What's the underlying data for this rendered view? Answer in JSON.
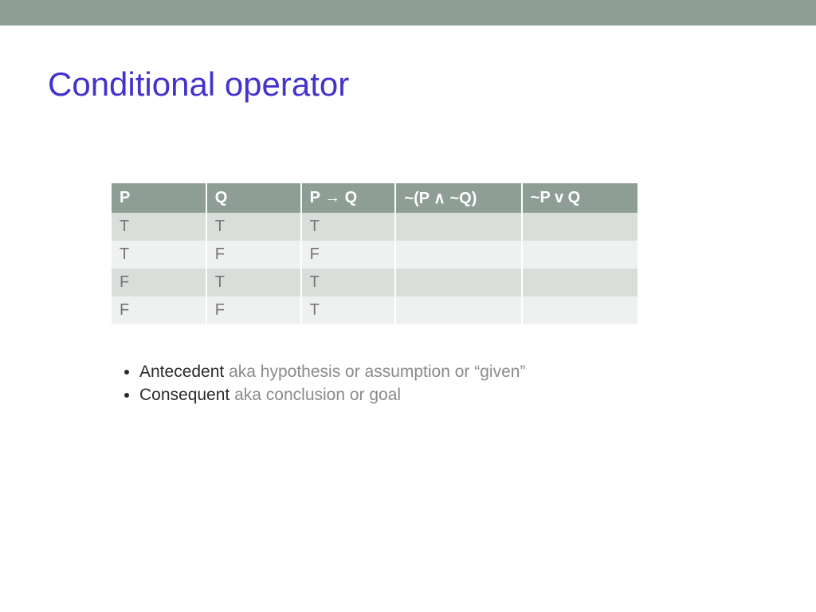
{
  "title": "Conditional operator",
  "table": {
    "headers": [
      "P",
      "Q",
      "P → Q",
      "~(P ∧ ~Q)",
      "~P v Q"
    ],
    "rows": [
      [
        "T",
        "T",
        "T",
        "",
        ""
      ],
      [
        "T",
        "F",
        "F",
        "",
        ""
      ],
      [
        "F",
        "T",
        "T",
        "",
        ""
      ],
      [
        "F",
        "F",
        "T",
        "",
        ""
      ]
    ]
  },
  "bullets": [
    {
      "strong": "Antecedent",
      "aka": " aka hypothesis or assumption or “given”"
    },
    {
      "strong": "Consequent",
      "aka": " aka conclusion or goal"
    }
  ]
}
